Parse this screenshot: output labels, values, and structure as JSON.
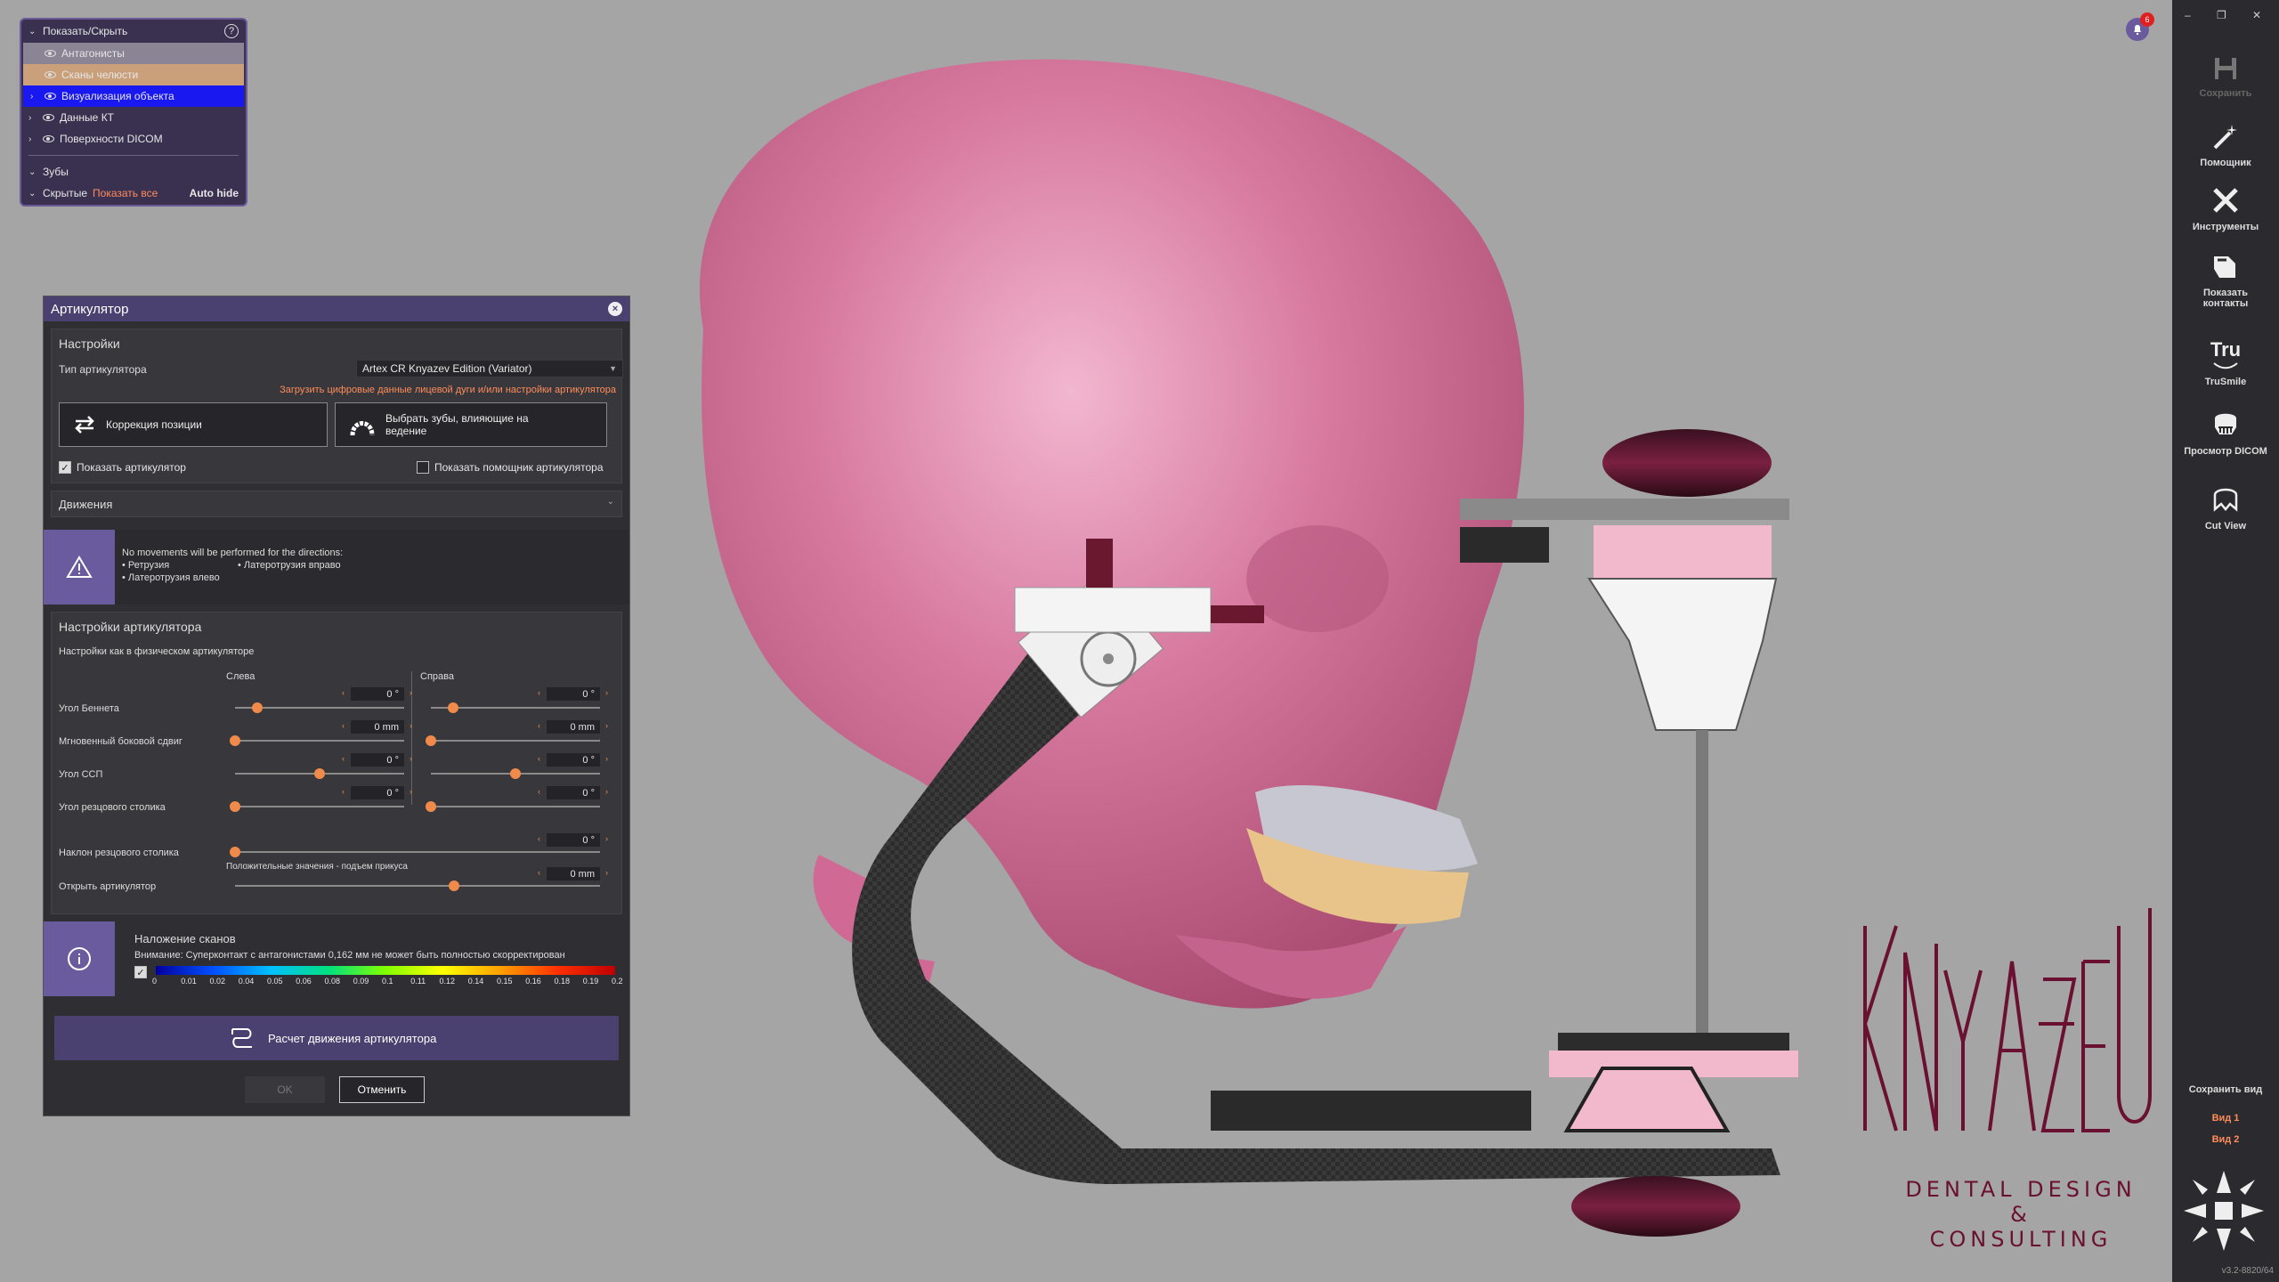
{
  "tree": {
    "header": "Показать/Скрыть",
    "help": "?",
    "items": [
      {
        "label": "Антагонисты"
      },
      {
        "label": "Сканы челюсти"
      },
      {
        "label": "Визуализация объекта"
      },
      {
        "label": "Данные КТ"
      },
      {
        "label": "Поверхности DICOM"
      }
    ],
    "teeth": "Зубы",
    "hidden": "Скрытые",
    "show_all": "Показать все",
    "auto_hide": "Auto hide"
  },
  "dialog": {
    "title": "Артикулятор",
    "settings": {
      "title": "Настройки",
      "type_label": "Тип артикулятора",
      "type_value": "Artex CR Knyazev Edition (Variator)",
      "load_link": "Загрузить цифровые данные лицевой дуги и/или настройки артикулятора",
      "btn_correction": "Коррекция позиции",
      "btn_select_teeth": "Выбрать зубы, влияющие на ведение",
      "show_articulator": "Показать артикулятор",
      "show_helper": "Показать помощник артикулятора"
    },
    "movements": {
      "title": "Движения"
    },
    "warning": {
      "line1": "No movements will be performed for the directions:",
      "item1": "• Ретрузия",
      "item2": "• Латеротрузия вправо",
      "item3": "• Латеротрузия влево"
    },
    "art_settings": {
      "title": "Настройки артикулятора",
      "sub": "Настройки как в физическом артикуляторе",
      "left": "Слева",
      "right": "Справа",
      "rows": [
        {
          "label": "Угол Беннета",
          "left_value": "0 °",
          "right_value": "0 °",
          "left_pos": 0.13,
          "right_pos": 0.13
        },
        {
          "label": "Мгновенный боковой сдвиг",
          "left_value": "0 mm",
          "right_value": "0 mm",
          "left_pos": 0.0,
          "right_pos": 0.0
        },
        {
          "label": "Угол ССП",
          "left_value": "0 °",
          "right_value": "0 °",
          "left_pos": 0.5,
          "right_pos": 0.5
        },
        {
          "label": "Угол резцового столика",
          "left_value": "0 °",
          "right_value": "0 °",
          "left_pos": 0.0,
          "right_pos": 0.0
        }
      ],
      "incline_label": "Наклон резцового столика",
      "incline_value": "0 °",
      "incline_pos": 0.0,
      "open_label": "Открыть артикулятор",
      "open_hint": "Положительные значения - подъем прикуса",
      "open_value": "0 mm",
      "open_pos": 0.6
    },
    "overlay": {
      "title": "Наложение сканов",
      "warning": "Внимание: Суперконтакт с антагонистами 0,162 мм не может быть полностью скорректирован",
      "scale": [
        "0",
        "0.01",
        "0.02",
        "0.04",
        "0.05",
        "0.06",
        "0.08",
        "0.09",
        "0.1",
        "0.11",
        "0.12",
        "0.14",
        "0.15",
        "0.16",
        "0.18",
        "0.19",
        "0.2"
      ]
    },
    "calc_button": "Расчет движения артикулятора",
    "ok": "OK",
    "cancel": "Отменить"
  },
  "sidebar": {
    "save": "Сохранить",
    "assistant": "Помощник",
    "tools": "Инструменты",
    "show_contacts_1": "Показать",
    "show_contacts_2": "контакты",
    "trusmile_logo": "Tru",
    "trusmile": "TruSmile",
    "dicom": "Просмотр DICOM",
    "cut": "Cut View",
    "save_view": "Сохранить вид",
    "view1": "Вид 1",
    "view2": "Вид 2",
    "version": "v3.2-8820/64"
  },
  "notifications": {
    "count": "6"
  },
  "brand": {
    "sub1": "DENTAL DESIGN",
    "sub2": "&",
    "sub3": "CONSULTING"
  },
  "colors": {
    "accent": "#6a5b9e",
    "link": "#ff8c5a",
    "skull": "#d87aa0",
    "brand": "#6a1030"
  }
}
